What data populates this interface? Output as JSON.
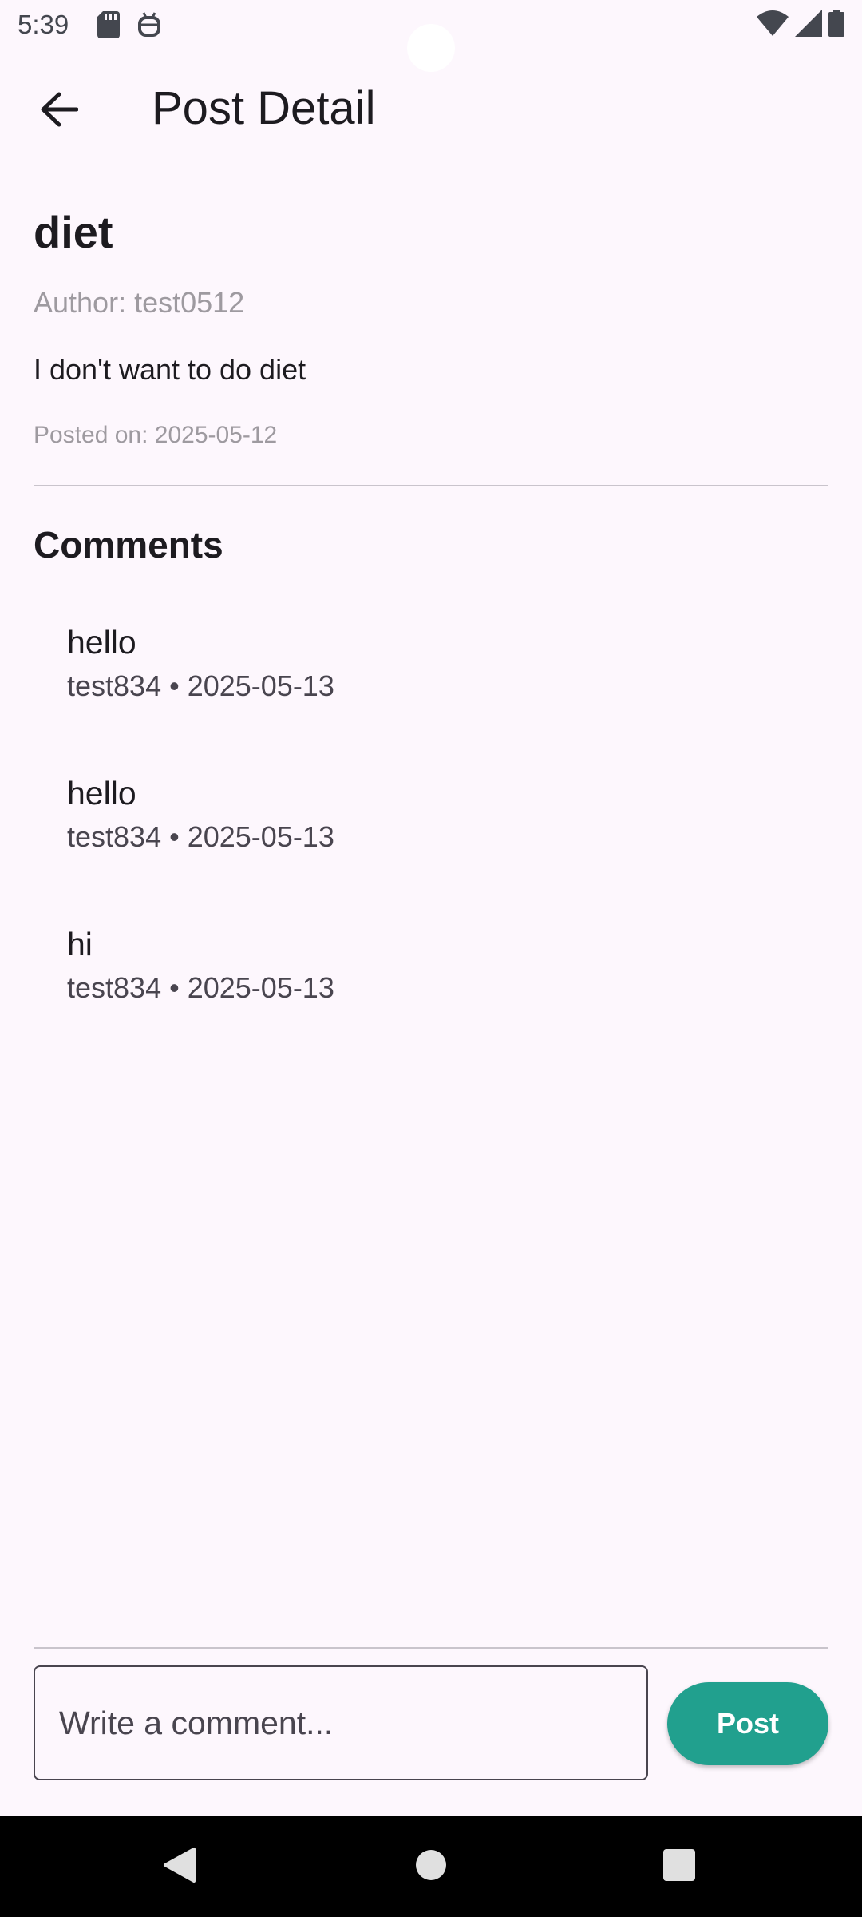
{
  "status_bar": {
    "time": "5:39",
    "icons_left": [
      "sd-card-icon",
      "robot-icon"
    ],
    "icons_right": [
      "wifi-icon",
      "signal-icon",
      "battery-icon"
    ]
  },
  "app_bar": {
    "title": "Post Detail",
    "back_icon": "arrow-back-icon"
  },
  "post": {
    "title": "diet",
    "author": "Author: test0512",
    "content": "I don't want to do diet",
    "posted_on": "Posted on: 2025-05-12"
  },
  "comments": {
    "heading": "Comments",
    "items": [
      {
        "text": "hello",
        "meta": "test834 • 2025-05-13"
      },
      {
        "text": "hello",
        "meta": "test834 • 2025-05-13"
      },
      {
        "text": "hi",
        "meta": "test834 • 2025-05-13"
      }
    ]
  },
  "composer": {
    "placeholder": "Write a comment...",
    "post_label": "Post"
  },
  "colors": {
    "background": "#fdf7fd",
    "accent": "#21a08e",
    "muted_text": "#9e9aa0"
  },
  "nav_bar": {
    "icons": [
      "back-triangle-icon",
      "home-circle-icon",
      "recents-square-icon"
    ]
  }
}
